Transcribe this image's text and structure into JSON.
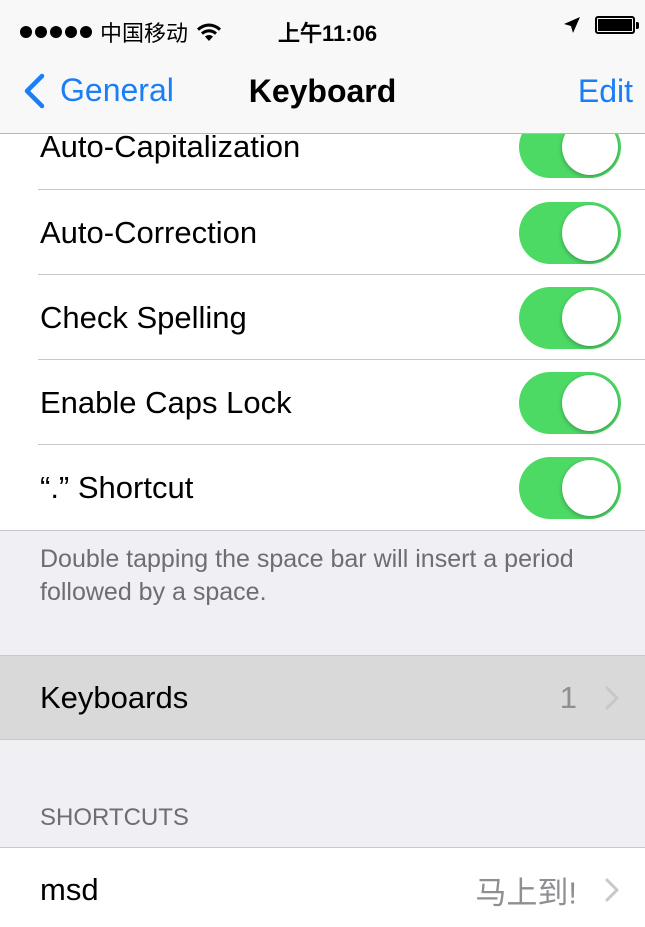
{
  "status_bar": {
    "carrier": "中国移动",
    "time": "上午11:06",
    "icons": [
      "signal-dots-icon",
      "wifi-icon",
      "location-arrow-icon",
      "battery-icon"
    ]
  },
  "nav": {
    "back_label": "General",
    "title": "Keyboard",
    "edit_label": "Edit"
  },
  "settings": {
    "toggles": [
      {
        "label": "Auto-Capitalization",
        "on": true
      },
      {
        "label": "Auto-Correction",
        "on": true
      },
      {
        "label": "Check Spelling",
        "on": true
      },
      {
        "label": "Enable Caps Lock",
        "on": true
      },
      {
        "label": "“.” Shortcut",
        "on": true
      }
    ],
    "footer": "Double tapping the space bar will insert a period followed by a space."
  },
  "keyboards": {
    "label": "Keyboards",
    "count": "1"
  },
  "shortcuts": {
    "header": "SHORTCUTS",
    "items": [
      {
        "phrase": "msd",
        "value": "马上到!"
      }
    ]
  },
  "colors": {
    "accent": "#1a7ef7",
    "toggle_on": "#4cd964",
    "background": "#efeff4"
  }
}
